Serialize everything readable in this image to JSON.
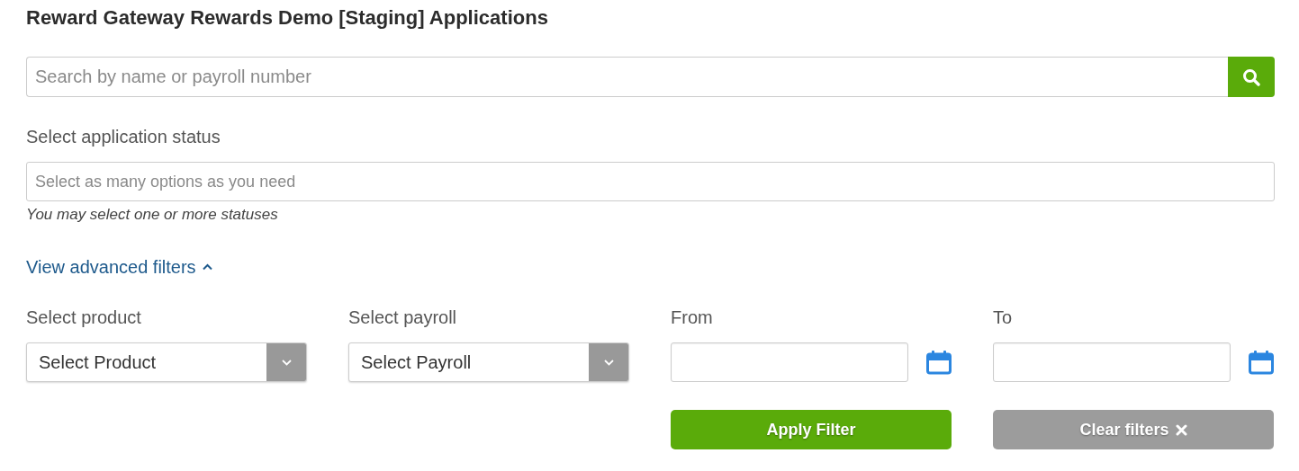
{
  "title": "Reward Gateway Rewards Demo [Staging] Applications",
  "search": {
    "placeholder": "Search by name or payroll number"
  },
  "status_filter": {
    "label": "Select application status",
    "placeholder": "Select as many options as you need",
    "help": "You may select one or more statuses"
  },
  "advanced_filters": {
    "label": "View advanced filters",
    "expanded": true
  },
  "filters": [
    {
      "kind": "select",
      "label": "Select product",
      "value": "Select Product"
    },
    {
      "kind": "select",
      "label": "Select payroll",
      "value": "Select Payroll"
    },
    {
      "kind": "date",
      "label": "From"
    },
    {
      "kind": "date",
      "label": "To"
    }
  ],
  "buttons": [
    {
      "kind": "primary",
      "label": "Apply Filter"
    },
    {
      "kind": "secondary",
      "label": "Clear filters"
    }
  ]
}
